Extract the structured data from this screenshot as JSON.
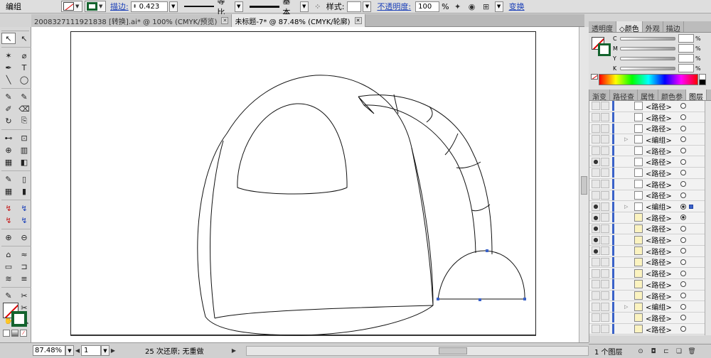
{
  "control_bar": {
    "context_label": "编组",
    "stroke_link": "描边:",
    "stroke_weight": "0.423",
    "profile_label": "等比",
    "brush_label": "基本",
    "style_label": "样式:",
    "opacity_link": "不透明度:",
    "opacity_value": "100",
    "opacity_unit": "%",
    "transform_link": "变换"
  },
  "tabs": [
    {
      "label": "2008327111921838 [转换].ai* @ 100% (CMYK/预览)"
    },
    {
      "label": "未标题-7* @ 87.48% (CMYK/轮廓)"
    }
  ],
  "tools": [
    "↖",
    "↖",
    "✶",
    "⌀",
    "✒",
    "T",
    "╲",
    "◯",
    "✎",
    "✎",
    "✐",
    "⌫",
    "↻",
    "⎘",
    "⊷",
    "⊡",
    "⊕",
    "▥",
    "▦",
    "◧",
    "✎",
    "▯",
    "▦",
    "▮",
    "↯",
    "↯",
    "↯",
    "↯",
    "⊕",
    "⊖",
    "⌂",
    "≈",
    "▭",
    "⊐",
    "≋",
    "≡",
    "✎",
    "✂",
    "☐",
    "✂",
    "✋",
    "🔍"
  ],
  "status_bar": {
    "zoom": "87.48%",
    "page": "1",
    "status": "25 次还原; 无重做"
  },
  "color_panel": {
    "tabs": [
      "透明度",
      "◇颜色",
      "外观",
      "描边"
    ],
    "channels": [
      "C",
      "M",
      "Y",
      "K"
    ],
    "percent": "%"
  },
  "layers_panel": {
    "tabs": [
      "渐变",
      "路径查",
      "属性",
      "颜色参",
      "图层"
    ],
    "rows": [
      {
        "name": "<路径>",
        "eye": false,
        "group": false,
        "yellow": false,
        "filled": false
      },
      {
        "name": "<路径>",
        "eye": false,
        "group": false,
        "yellow": false,
        "filled": false
      },
      {
        "name": "<路径>",
        "eye": false,
        "group": false,
        "yellow": false,
        "filled": false
      },
      {
        "name": "<编组>",
        "eye": false,
        "group": true,
        "yellow": false,
        "filled": false
      },
      {
        "name": "<路径>",
        "eye": false,
        "group": false,
        "yellow": false,
        "filled": false
      },
      {
        "name": "<路径>",
        "eye": true,
        "group": false,
        "yellow": false,
        "filled": false
      },
      {
        "name": "<路径>",
        "eye": false,
        "group": false,
        "yellow": false,
        "filled": false
      },
      {
        "name": "<路径>",
        "eye": false,
        "group": false,
        "yellow": false,
        "filled": false
      },
      {
        "name": "<路径>",
        "eye": false,
        "group": false,
        "yellow": false,
        "filled": false
      },
      {
        "name": "<编组>",
        "eye": true,
        "group": true,
        "yellow": false,
        "filled": false,
        "selected": true
      },
      {
        "name": "<路径>",
        "eye": true,
        "group": false,
        "yellow": true,
        "filled": true
      },
      {
        "name": "<路径>",
        "eye": true,
        "group": false,
        "yellow": true,
        "filled": false
      },
      {
        "name": "<路径>",
        "eye": true,
        "group": false,
        "yellow": true,
        "filled": false
      },
      {
        "name": "<路径>",
        "eye": true,
        "group": false,
        "yellow": true,
        "filled": false
      },
      {
        "name": "<路径>",
        "eye": false,
        "group": false,
        "yellow": true,
        "filled": false
      },
      {
        "name": "<路径>",
        "eye": false,
        "group": false,
        "yellow": true,
        "filled": false
      },
      {
        "name": "<路径>",
        "eye": false,
        "group": false,
        "yellow": true,
        "filled": false
      },
      {
        "name": "<路径>",
        "eye": false,
        "group": false,
        "yellow": true,
        "filled": false
      },
      {
        "name": "<编组>",
        "eye": false,
        "group": true,
        "yellow": true,
        "filled": false
      },
      {
        "name": "<路径>",
        "eye": false,
        "group": false,
        "yellow": true,
        "filled": false
      },
      {
        "name": "<路径>",
        "eye": false,
        "group": false,
        "yellow": true,
        "filled": false
      }
    ],
    "count": "1 个图层"
  },
  "colors": {
    "stroke_green": "#14632e",
    "link_blue": "#1a3fb8",
    "layer_blue": "#3a62c9"
  }
}
